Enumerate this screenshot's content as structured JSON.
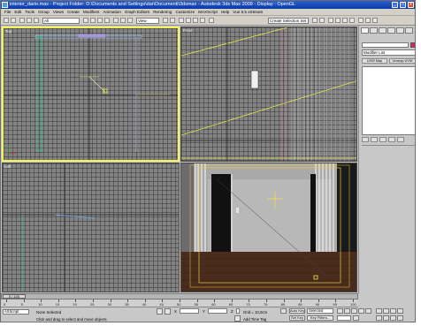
{
  "window": {
    "title": "interior_dario.max    - Project Folder: D:\\Documents and Settings\\dar\\Documenti\\3dsmax      - Autodesk 3ds Max 2009     - Display : OpenGL",
    "min_label": "_",
    "max_label": "□",
    "close_label": "x"
  },
  "menu": [
    "File",
    "Edit",
    "Tools",
    "Group",
    "Views",
    "Create",
    "Modifiers",
    "Animation",
    "Graph Editors",
    "Rendering",
    "Customize",
    "MAXScript",
    "Help",
    "Vue 6.5 xStream"
  ],
  "toolbar": {
    "selection_filter": "All",
    "coord_system": "View",
    "named_selection_placeholder": "Create Selection Set"
  },
  "viewports": {
    "top_left_label": "Top",
    "top_right_label": "Front",
    "bottom_left_label": "Left",
    "bottom_right_label": "Camera01"
  },
  "command_panel": {
    "modifier_list": "Modifier List",
    "btn_uvw_map": "UVW Map",
    "btn_unwrap_uvw": "Unwrap UVW"
  },
  "timeline": {
    "frame_readout": "0 / 100",
    "ticks": [
      "0",
      "5",
      "10",
      "15",
      "20",
      "25",
      "30",
      "35",
      "40",
      "45",
      "50",
      "55",
      "60",
      "65",
      "70",
      "75",
      "80",
      "85",
      "90",
      "95",
      "100"
    ]
  },
  "status": {
    "maxscript": "AXScript",
    "selection": "None Selected",
    "prompt": "Click and drag to select and move objects",
    "x_label": "X",
    "y_label": "Y",
    "z_label": "Z",
    "grid": "Grid = 10,0cm",
    "add_time_tag": "Add Time Tag",
    "auto_key": "Auto Key",
    "selected_option": "Selected",
    "set_key": "Set Key",
    "key_filters": "Key Filters..."
  },
  "colors": {
    "title_bar": "#0a3aa8",
    "viewport_bg": "#838383",
    "active_border": "#f2f25a",
    "name_swatch": "#e0206a"
  }
}
